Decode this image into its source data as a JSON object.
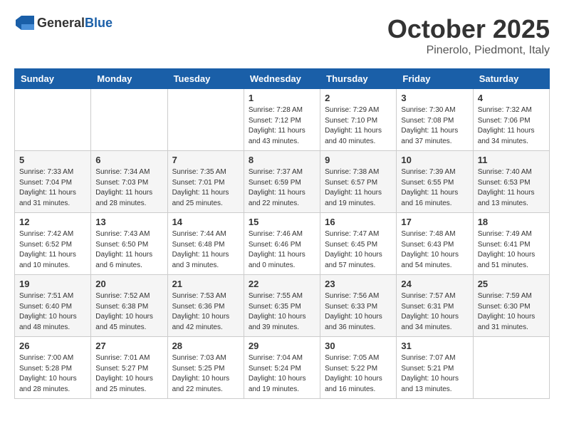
{
  "header": {
    "logo": {
      "general": "General",
      "blue": "Blue"
    },
    "title": "October 2025",
    "location": "Pinerolo, Piedmont, Italy"
  },
  "calendar": {
    "days_of_week": [
      "Sunday",
      "Monday",
      "Tuesday",
      "Wednesday",
      "Thursday",
      "Friday",
      "Saturday"
    ],
    "weeks": [
      [
        {
          "day": "",
          "info": ""
        },
        {
          "day": "",
          "info": ""
        },
        {
          "day": "",
          "info": ""
        },
        {
          "day": "1",
          "info": "Sunrise: 7:28 AM\nSunset: 7:12 PM\nDaylight: 11 hours and 43 minutes."
        },
        {
          "day": "2",
          "info": "Sunrise: 7:29 AM\nSunset: 7:10 PM\nDaylight: 11 hours and 40 minutes."
        },
        {
          "day": "3",
          "info": "Sunrise: 7:30 AM\nSunset: 7:08 PM\nDaylight: 11 hours and 37 minutes."
        },
        {
          "day": "4",
          "info": "Sunrise: 7:32 AM\nSunset: 7:06 PM\nDaylight: 11 hours and 34 minutes."
        }
      ],
      [
        {
          "day": "5",
          "info": "Sunrise: 7:33 AM\nSunset: 7:04 PM\nDaylight: 11 hours and 31 minutes."
        },
        {
          "day": "6",
          "info": "Sunrise: 7:34 AM\nSunset: 7:03 PM\nDaylight: 11 hours and 28 minutes."
        },
        {
          "day": "7",
          "info": "Sunrise: 7:35 AM\nSunset: 7:01 PM\nDaylight: 11 hours and 25 minutes."
        },
        {
          "day": "8",
          "info": "Sunrise: 7:37 AM\nSunset: 6:59 PM\nDaylight: 11 hours and 22 minutes."
        },
        {
          "day": "9",
          "info": "Sunrise: 7:38 AM\nSunset: 6:57 PM\nDaylight: 11 hours and 19 minutes."
        },
        {
          "day": "10",
          "info": "Sunrise: 7:39 AM\nSunset: 6:55 PM\nDaylight: 11 hours and 16 minutes."
        },
        {
          "day": "11",
          "info": "Sunrise: 7:40 AM\nSunset: 6:53 PM\nDaylight: 11 hours and 13 minutes."
        }
      ],
      [
        {
          "day": "12",
          "info": "Sunrise: 7:42 AM\nSunset: 6:52 PM\nDaylight: 11 hours and 10 minutes."
        },
        {
          "day": "13",
          "info": "Sunrise: 7:43 AM\nSunset: 6:50 PM\nDaylight: 11 hours and 6 minutes."
        },
        {
          "day": "14",
          "info": "Sunrise: 7:44 AM\nSunset: 6:48 PM\nDaylight: 11 hours and 3 minutes."
        },
        {
          "day": "15",
          "info": "Sunrise: 7:46 AM\nSunset: 6:46 PM\nDaylight: 11 hours and 0 minutes."
        },
        {
          "day": "16",
          "info": "Sunrise: 7:47 AM\nSunset: 6:45 PM\nDaylight: 10 hours and 57 minutes."
        },
        {
          "day": "17",
          "info": "Sunrise: 7:48 AM\nSunset: 6:43 PM\nDaylight: 10 hours and 54 minutes."
        },
        {
          "day": "18",
          "info": "Sunrise: 7:49 AM\nSunset: 6:41 PM\nDaylight: 10 hours and 51 minutes."
        }
      ],
      [
        {
          "day": "19",
          "info": "Sunrise: 7:51 AM\nSunset: 6:40 PM\nDaylight: 10 hours and 48 minutes."
        },
        {
          "day": "20",
          "info": "Sunrise: 7:52 AM\nSunset: 6:38 PM\nDaylight: 10 hours and 45 minutes."
        },
        {
          "day": "21",
          "info": "Sunrise: 7:53 AM\nSunset: 6:36 PM\nDaylight: 10 hours and 42 minutes."
        },
        {
          "day": "22",
          "info": "Sunrise: 7:55 AM\nSunset: 6:35 PM\nDaylight: 10 hours and 39 minutes."
        },
        {
          "day": "23",
          "info": "Sunrise: 7:56 AM\nSunset: 6:33 PM\nDaylight: 10 hours and 36 minutes."
        },
        {
          "day": "24",
          "info": "Sunrise: 7:57 AM\nSunset: 6:31 PM\nDaylight: 10 hours and 34 minutes."
        },
        {
          "day": "25",
          "info": "Sunrise: 7:59 AM\nSunset: 6:30 PM\nDaylight: 10 hours and 31 minutes."
        }
      ],
      [
        {
          "day": "26",
          "info": "Sunrise: 7:00 AM\nSunset: 5:28 PM\nDaylight: 10 hours and 28 minutes."
        },
        {
          "day": "27",
          "info": "Sunrise: 7:01 AM\nSunset: 5:27 PM\nDaylight: 10 hours and 25 minutes."
        },
        {
          "day": "28",
          "info": "Sunrise: 7:03 AM\nSunset: 5:25 PM\nDaylight: 10 hours and 22 minutes."
        },
        {
          "day": "29",
          "info": "Sunrise: 7:04 AM\nSunset: 5:24 PM\nDaylight: 10 hours and 19 minutes."
        },
        {
          "day": "30",
          "info": "Sunrise: 7:05 AM\nSunset: 5:22 PM\nDaylight: 10 hours and 16 minutes."
        },
        {
          "day": "31",
          "info": "Sunrise: 7:07 AM\nSunset: 5:21 PM\nDaylight: 10 hours and 13 minutes."
        },
        {
          "day": "",
          "info": ""
        }
      ]
    ]
  }
}
